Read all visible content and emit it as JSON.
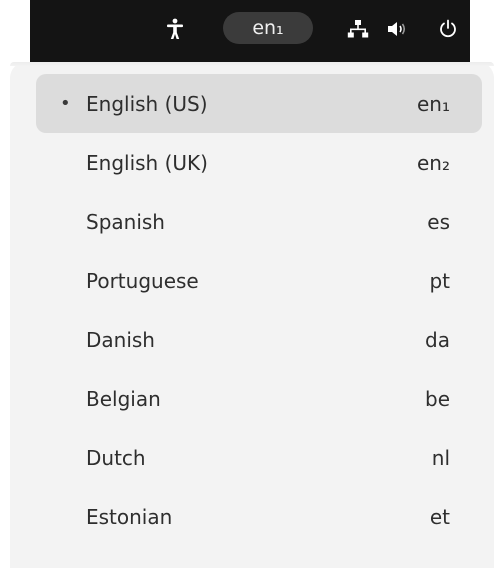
{
  "topbar": {
    "icons": {
      "accessibility": "accessibility-icon",
      "network": "network-icon",
      "volume": "volume-icon",
      "power": "power-icon"
    },
    "language_indicator": "en₁"
  },
  "menu": {
    "selected_index": 0,
    "items": [
      {
        "name": "English (US)",
        "code": "en₁",
        "selected": true
      },
      {
        "name": "English (UK)",
        "code": "en₂",
        "selected": false
      },
      {
        "name": "Spanish",
        "code": "es",
        "selected": false
      },
      {
        "name": "Portuguese",
        "code": "pt",
        "selected": false
      },
      {
        "name": "Danish",
        "code": "da",
        "selected": false
      },
      {
        "name": "Belgian",
        "code": "be",
        "selected": false
      },
      {
        "name": "Dutch",
        "code": "nl",
        "selected": false
      },
      {
        "name": "Estonian",
        "code": "et",
        "selected": false
      }
    ],
    "bullet": "•"
  },
  "colors": {
    "topbar_bg": "#141414",
    "popup_bg": "#f3f3f3",
    "selected_bg": "#dcdcdc",
    "text": "#2e2e2e"
  }
}
